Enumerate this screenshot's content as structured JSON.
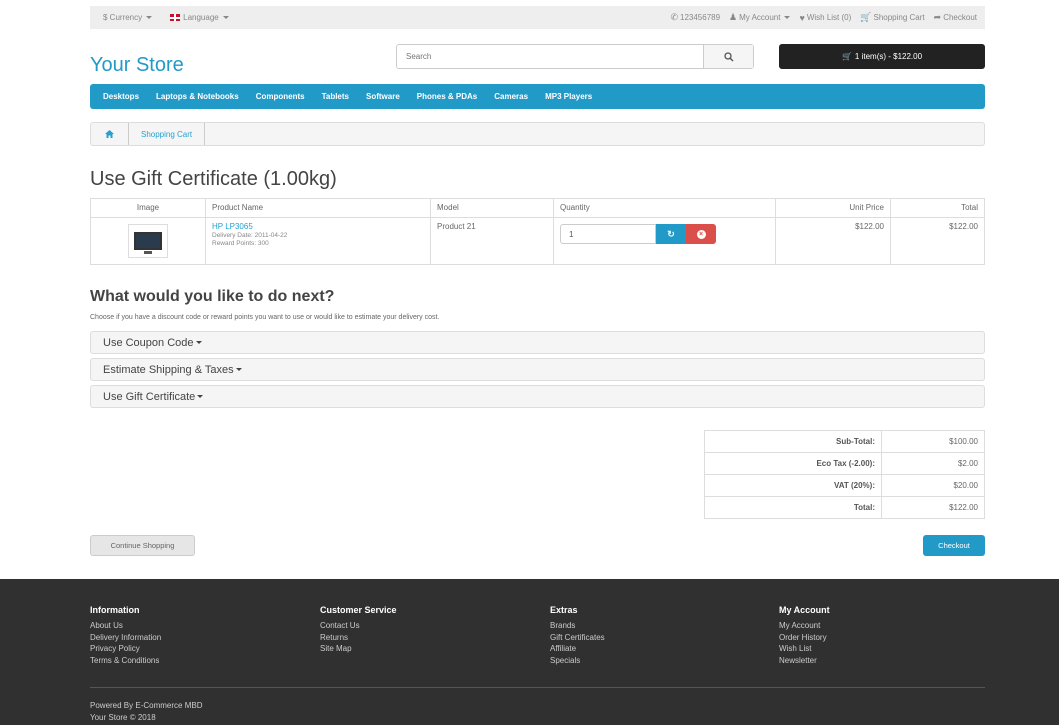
{
  "topbar": {
    "currency_label": "$ Currency",
    "language_label": "Language",
    "phone": "123456789",
    "my_account": "My Account",
    "wish_list": "Wish List (0)",
    "shopping_cart": "Shopping Cart",
    "checkout": "Checkout"
  },
  "header": {
    "logo": "Your Store",
    "search_placeholder": "Search",
    "cart_summary": "1 item(s) - $122.00"
  },
  "menu": [
    "Desktops",
    "Laptops & Notebooks",
    "Components",
    "Tablets",
    "Software",
    "Phones & PDAs",
    "Cameras",
    "MP3 Players"
  ],
  "breadcrumb": {
    "current": "Shopping Cart"
  },
  "page": {
    "title": "Use Gift Certificate  (1.00kg)"
  },
  "cart": {
    "columns": [
      "Image",
      "Product Name",
      "Model",
      "Quantity",
      "Unit Price",
      "Total"
    ],
    "rows": [
      {
        "name": "HP LP3065",
        "delivery": "Delivery Date: 2011-04-22",
        "reward": "Reward Points: 300",
        "model": "Product 21",
        "quantity": "1",
        "unit_price": "$122.00",
        "total": "$122.00"
      }
    ]
  },
  "next": {
    "title": "What would you like to do next?",
    "description": "Choose if you have a discount code or reward points you want to use or would like to estimate your delivery cost.",
    "panels": [
      "Use Coupon Code",
      "Estimate Shipping & Taxes",
      "Use Gift Certificate"
    ]
  },
  "totals": [
    {
      "label": "Sub-Total:",
      "value": "$100.00"
    },
    {
      "label": "Eco Tax (-2.00):",
      "value": "$2.00"
    },
    {
      "label": "VAT (20%):",
      "value": "$20.00"
    },
    {
      "label": "Total:",
      "value": "$122.00"
    }
  ],
  "actions": {
    "continue": "Continue Shopping",
    "checkout": "Checkout"
  },
  "footer": {
    "columns": [
      {
        "title": "Information",
        "links": [
          "About Us",
          "Delivery Information",
          "Privacy Policy",
          "Terms & Conditions"
        ]
      },
      {
        "title": "Customer Service",
        "links": [
          "Contact Us",
          "Returns",
          "Site Map"
        ]
      },
      {
        "title": "Extras",
        "links": [
          "Brands",
          "Gift Certificates",
          "Affiliate",
          "Specials"
        ]
      },
      {
        "title": "My Account",
        "links": [
          "My Account",
          "Order History",
          "Wish List",
          "Newsletter"
        ]
      }
    ],
    "powered_by": "Powered By E-Commerce MBD",
    "copyright": "Your Store © 2018"
  },
  "colors": {
    "brand_blue": "#229ac8",
    "link_blue": "#23a1d1",
    "danger_red": "#da4f49",
    "footer_bg": "#303030"
  }
}
